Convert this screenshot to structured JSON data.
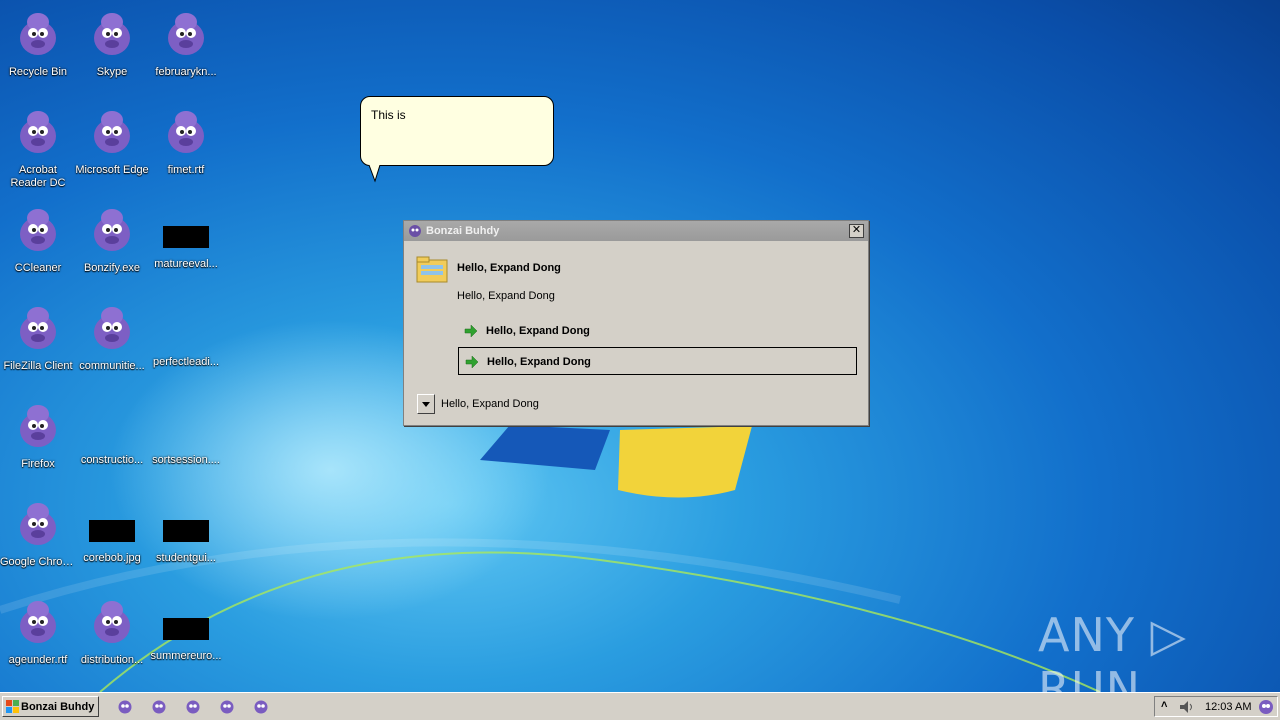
{
  "desktop": {
    "icons": [
      {
        "label": "Recycle Bin"
      },
      {
        "label": "Skype"
      },
      {
        "label": "februarykn..."
      },
      {
        "label": "Acrobat Reader DC"
      },
      {
        "label": "Microsoft Edge"
      },
      {
        "label": "fimet.rtf"
      },
      {
        "label": "CCleaner"
      },
      {
        "label": "Bonzify.exe"
      },
      {
        "label": "matureeval..."
      },
      {
        "label": "FileZilla Client"
      },
      {
        "label": "communitie..."
      },
      {
        "label": "perfectleadi..."
      },
      {
        "label": "Firefox"
      },
      {
        "label": "constructio..."
      },
      {
        "label": "sortsession...."
      },
      {
        "label": "Google Chrome"
      },
      {
        "label": "corebob.jpg"
      },
      {
        "label": "studentgui..."
      },
      {
        "label": "ageunder.rtf"
      },
      {
        "label": "distribution..."
      },
      {
        "label": "summereuro..."
      }
    ]
  },
  "bubble": {
    "text": "This is"
  },
  "dialog": {
    "title": "Bonzai Buhdy",
    "close_label": "✕",
    "heading": "Hello, Expand Dong",
    "subtext": "Hello, Expand Dong",
    "options": [
      {
        "label": "Hello, Expand Dong"
      },
      {
        "label": "Hello, Expand Dong"
      }
    ],
    "dropdown_label": "Hello, Expand Dong"
  },
  "taskbar": {
    "start_label": "Bonzai Buhdy",
    "clock": "12:03 AM",
    "tray_chevron": "˄"
  },
  "watermark": {
    "text": "ANY ▷ RUN"
  }
}
